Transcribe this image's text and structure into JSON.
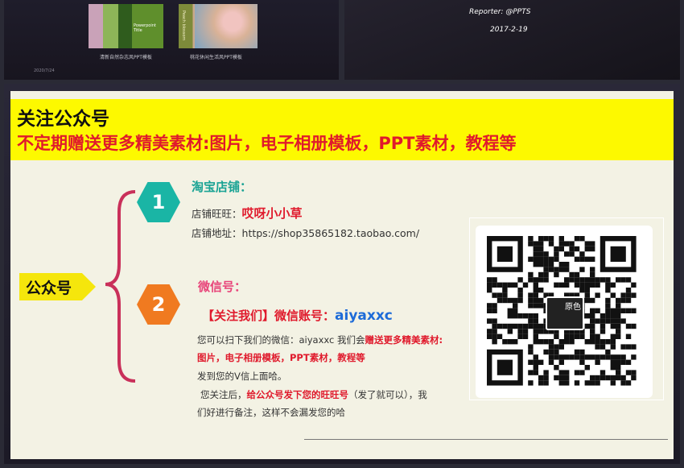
{
  "top": {
    "thumb1_title": "Powerpoint Title",
    "thumb2_vertical": "Peach blossom",
    "caption1": "清新自然杂志风PPT模板",
    "caption2": "桃花休闲生活风PPT模板",
    "date_small": "2020/7/24",
    "reporter": "Reporter: @PPTS",
    "date2": "2017-2-19"
  },
  "banner": {
    "line1": "关注公众号",
    "line2": "不定期赠送更多精美素材:图片，电子相册模板，PPT素材，教程等"
  },
  "left_label": "公众号",
  "step1": {
    "number": "1",
    "heading": "淘宝店铺：",
    "wangwang_label": "店铺旺旺：",
    "wangwang_value": "哎呀小小草",
    "address_label": "店铺地址：",
    "address_value": "https://shop35865182.taobao.com/"
  },
  "step2": {
    "number": "2",
    "heading": "微信号：",
    "follow_label": "【关注我们】微信账号：",
    "follow_value": "aiyaxxc",
    "p1a": "您可以扫下我们的微信：aiyaxxc 我们会",
    "p1b": "赠送更多精美素材:",
    "p2": "图片，电子相册模板，PPT素材，教程等",
    "p3": "发到您的V信上面哈。",
    "p4a": "您关注后，",
    "p4b": "给公众号发下您的旺旺号",
    "p4c": "（发了就可以），我",
    "p5": "们好进行备注，这样不会漏发您的哈"
  },
  "qr": {
    "logo_text": "原色"
  },
  "colors": {
    "banner": "#fdf900",
    "teal": "#1ab5a5",
    "orange": "#f07a20",
    "red": "#e01a2c",
    "pink": "#e8457a"
  }
}
